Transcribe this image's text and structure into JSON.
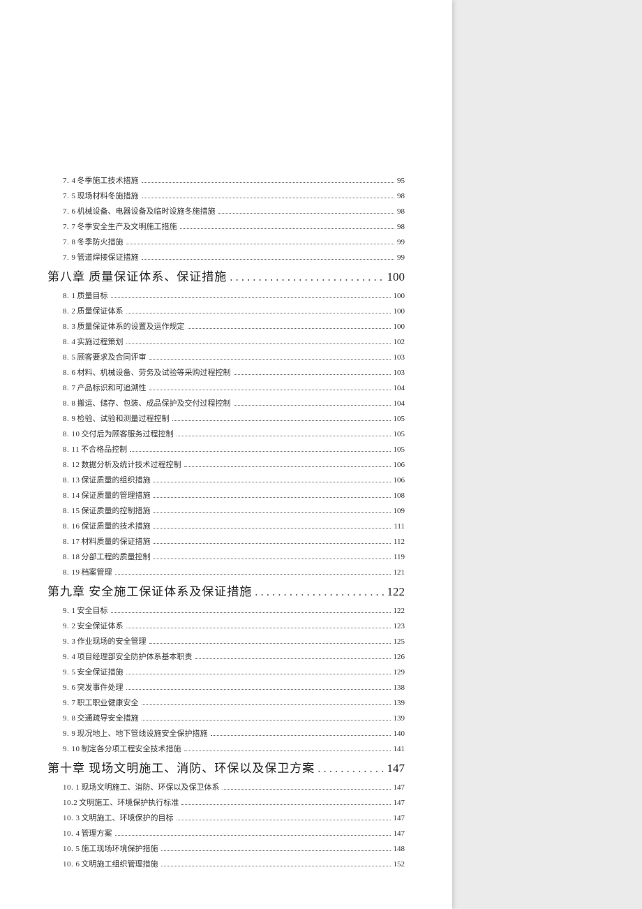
{
  "pre_items": [
    {
      "num": "7. 4",
      "label": "冬季施工技术措施",
      "page": "95"
    },
    {
      "num": "7. 5",
      "label": "现场材料冬施措施",
      "page": "98"
    },
    {
      "num": "7. 6",
      "label": "机械设备、电器设备及临时设施冬施措施",
      "page": "98"
    },
    {
      "num": "7. 7",
      "label": "冬季安全生产及文明施工措施",
      "page": "98"
    },
    {
      "num": "7. 8",
      "label": "冬季防火措施",
      "page": "99"
    },
    {
      "num": "7. 9",
      "label": "管道焊接保证措施",
      "page": "99"
    }
  ],
  "chapters": [
    {
      "title": "第八章   质量保证体系、保证措施",
      "page": "100",
      "items": [
        {
          "num": "8. 1",
          "label": "质量目标",
          "page": "100"
        },
        {
          "num": "8. 2",
          "label": "质量保证体系",
          "page": "100"
        },
        {
          "num": "8. 3",
          "label": "质量保证体系的设置及运作规定",
          "page": "100"
        },
        {
          "num": "8. 4",
          "label": "实施过程策划",
          "page": "102"
        },
        {
          "num": "8. 5",
          "label": "顾客要求及合同评审",
          "page": "103"
        },
        {
          "num": "8. 6",
          "label": "材料、机械设备、劳务及试验等采购过程控制",
          "page": "103"
        },
        {
          "num": "8. 7",
          "label": "产品标识和可追溯性",
          "page": "104"
        },
        {
          "num": "8. 8",
          "label": "搬运、储存、包装、成品保护及交付过程控制",
          "page": "104"
        },
        {
          "num": "8. 9",
          "label": "检验、试验和测量过程控制",
          "page": "105"
        },
        {
          "num": "8. 10",
          "label": "交付后为顾客服务过程控制",
          "page": "105"
        },
        {
          "num": "8. 11",
          "label": "不合格品控制",
          "page": "105"
        },
        {
          "num": "8. 12",
          "label": "数据分析及统计技术过程控制",
          "page": "106"
        },
        {
          "num": "8. 13",
          "label": "保证质量的组织措施",
          "page": "106"
        },
        {
          "num": "8. 14",
          "label": "保证质量的管理措施",
          "page": "108"
        },
        {
          "num": "8. 15",
          "label": "保证质量的控制措施",
          "page": "109"
        },
        {
          "num": "8. 16",
          "label": "保证质量的技术措施",
          "page": "111"
        },
        {
          "num": "8. 17",
          "label": "材料质量的保证措施",
          "page": "112"
        },
        {
          "num": "8. 18",
          "label": "分部工程的质量控制",
          "page": "119"
        },
        {
          "num": "8. 19",
          "label": "档案管理",
          "page": "121"
        }
      ]
    },
    {
      "title": "第九章   安全施工保证体系及保证措施",
      "page": "122",
      "items": [
        {
          "num": "9. 1",
          "label": " 安全目标",
          "page": "122"
        },
        {
          "num": "9. 2",
          "label": " 安全保证体系",
          "page": "123"
        },
        {
          "num": "9. 3",
          "label": "作业现场的安全管理",
          "page": "125"
        },
        {
          "num": "9. 4",
          "label": "项目经理部安全防护体系基本职责",
          "page": "126"
        },
        {
          "num": "9. 5",
          "label": " 安全保证措施",
          "page": "129"
        },
        {
          "num": "9. 6",
          "label": "突发事件处理",
          "page": "138"
        },
        {
          "num": "9. 7",
          "label": "职工职业健康安全",
          "page": "139"
        },
        {
          "num": "9. 8",
          "label": " 交通疏导安全措施",
          "page": "139"
        },
        {
          "num": "9. 9",
          "label": "现况地上、地下管线设施安全保护措施",
          "page": "140"
        },
        {
          "num": "9. 10",
          "label": "制定各分项工程安全技术措施",
          "page": "141"
        }
      ]
    },
    {
      "title": "第十章   现场文明施工、消防、环保以及保卫方案",
      "page": "147",
      "items": [
        {
          "num": "10. 1",
          "label": "现场文明施工、消防、环保以及保卫体系",
          "page": "147"
        },
        {
          "num": "10.2",
          "label": "文明施工、环境保护执行标准",
          "page": "147"
        },
        {
          "num": "10. 3",
          "label": "文明施工、环境保护的目标",
          "page": "147"
        },
        {
          "num": "10. 4",
          "label": "管理方案",
          "page": "147"
        },
        {
          "num": "10. 5",
          "label": "施工现场环境保护措施",
          "page": "148"
        },
        {
          "num": "10. 6",
          "label": "文明施工组织管理措施",
          "page": "152"
        }
      ]
    }
  ]
}
